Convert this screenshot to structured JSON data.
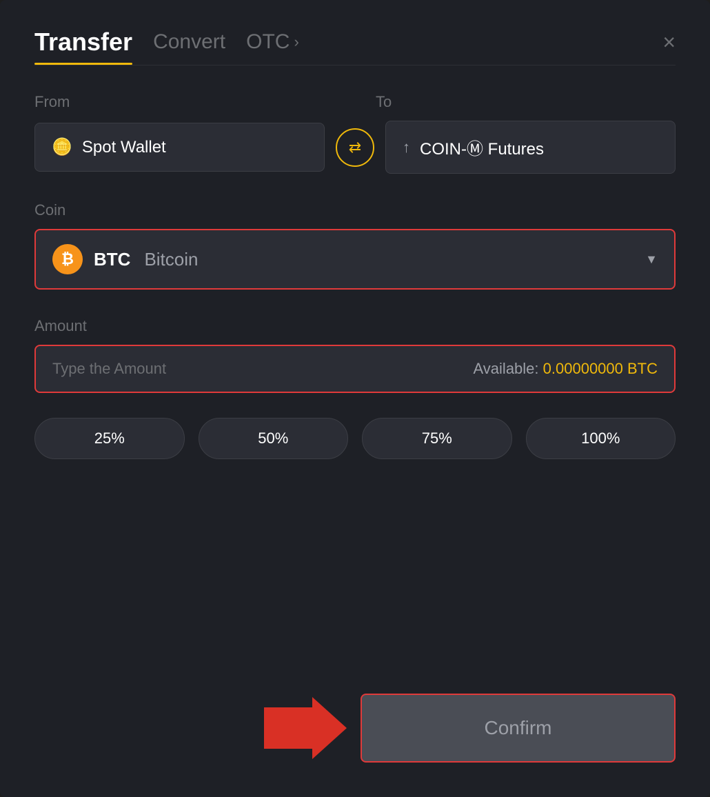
{
  "header": {
    "title_active": "Transfer",
    "tab_convert": "Convert",
    "tab_otc": "OTC",
    "close_label": "×"
  },
  "from_to": {
    "from_label": "From",
    "to_label": "To",
    "from_wallet": "Spot Wallet",
    "to_wallet": "COIN-Ⓜ Futures"
  },
  "coin": {
    "section_label": "Coin",
    "symbol": "BTC",
    "name": "Bitcoin"
  },
  "amount": {
    "section_label": "Amount",
    "placeholder": "Type the Amount",
    "available_label": "Available:",
    "available_value": "0.00000000 BTC"
  },
  "percentage_buttons": [
    {
      "label": "25%"
    },
    {
      "label": "50%"
    },
    {
      "label": "75%"
    },
    {
      "label": "100%"
    }
  ],
  "confirm_button": {
    "label": "Confirm"
  }
}
